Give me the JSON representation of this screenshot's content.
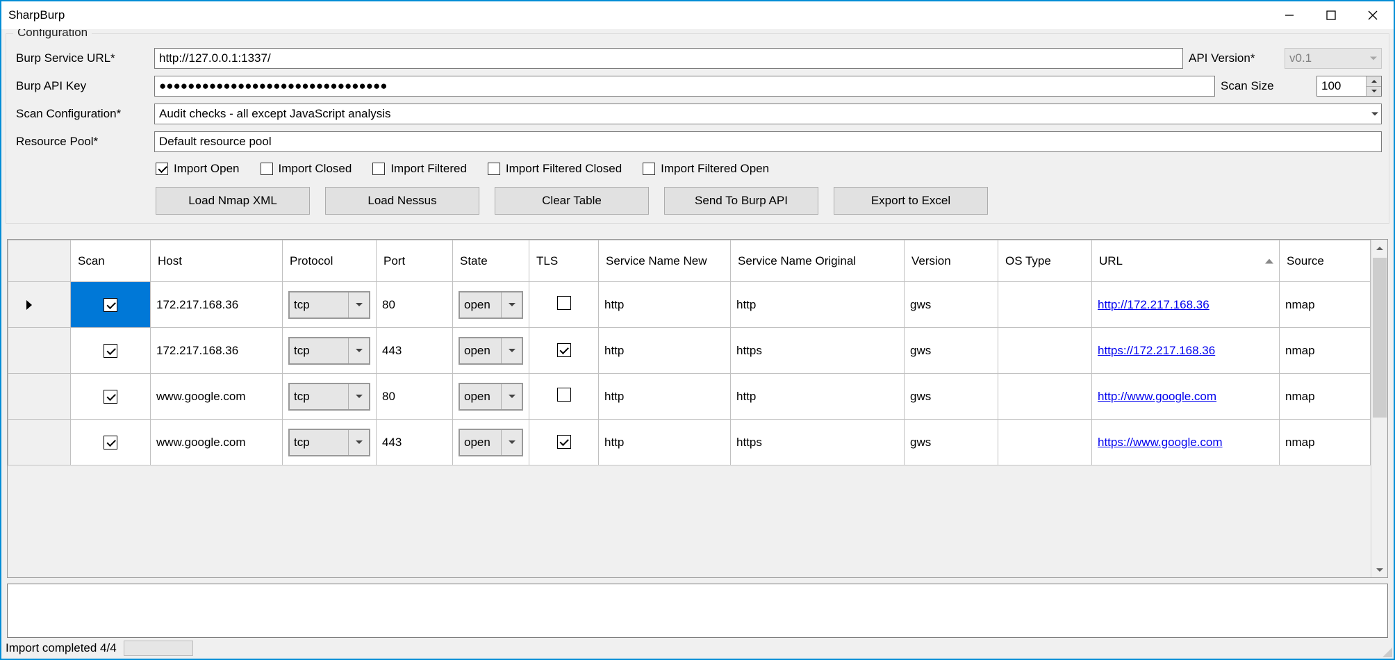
{
  "window": {
    "title": "SharpBurp"
  },
  "config": {
    "groupLabel": "Configuration",
    "labels": {
      "burpUrl": "Burp Service URL*",
      "apiKey": "Burp API Key",
      "scanConfig": "Scan Configuration*",
      "resourcePool": "Resource Pool*",
      "apiVersion": "API Version*",
      "scanSize": "Scan Size"
    },
    "values": {
      "burpUrl": "http://127.0.0.1:1337/",
      "apiKeyMasked": "●●●●●●●●●●●●●●●●●●●●●●●●●●●●●●●●",
      "scanConfig": "Audit checks - all except JavaScript analysis",
      "resourcePool": "Default resource pool",
      "apiVersion": "v0.1",
      "scanSize": "100"
    },
    "checkboxes": {
      "importOpen": {
        "label": "Import Open",
        "checked": true
      },
      "importClosed": {
        "label": "Import Closed",
        "checked": false
      },
      "importFiltered": {
        "label": "Import Filtered",
        "checked": false
      },
      "importFilteredClosed": {
        "label": "Import Filtered Closed",
        "checked": false
      },
      "importFilteredOpen": {
        "label": "Import Filtered Open",
        "checked": false
      }
    },
    "buttons": {
      "loadNmap": "Load Nmap XML",
      "loadNessus": "Load Nessus",
      "clearTable": "Clear Table",
      "sendBurp": "Send To Burp API",
      "exportExcel": "Export to Excel"
    }
  },
  "grid": {
    "columns": {
      "scan": "Scan",
      "host": "Host",
      "protocol": "Protocol",
      "port": "Port",
      "state": "State",
      "tls": "TLS",
      "serviceNameNew": "Service Name New",
      "serviceNameOriginal": "Service Name Original",
      "version": "Version",
      "osType": "OS Type",
      "url": "URL",
      "source": "Source"
    },
    "rows": [
      {
        "scan": true,
        "host": "172.217.168.36",
        "protocol": "tcp",
        "port": "80",
        "state": "open",
        "tls": false,
        "serviceNameNew": "http",
        "serviceNameOriginal": "http",
        "version": "gws",
        "osType": "",
        "url": "http://172.217.168.36",
        "source": "nmap"
      },
      {
        "scan": true,
        "host": "172.217.168.36",
        "protocol": "tcp",
        "port": "443",
        "state": "open",
        "tls": true,
        "serviceNameNew": "http",
        "serviceNameOriginal": "https",
        "version": "gws",
        "osType": "",
        "url": "https://172.217.168.36",
        "source": "nmap"
      },
      {
        "scan": true,
        "host": "www.google.com",
        "protocol": "tcp",
        "port": "80",
        "state": "open",
        "tls": false,
        "serviceNameNew": "http",
        "serviceNameOriginal": "http",
        "version": "gws",
        "osType": "",
        "url": "http://www.google.com",
        "source": "nmap"
      },
      {
        "scan": true,
        "host": "www.google.com",
        "protocol": "tcp",
        "port": "443",
        "state": "open",
        "tls": true,
        "serviceNameNew": "http",
        "serviceNameOriginal": "https",
        "version": "gws",
        "osType": "",
        "url": "https://www.google.com",
        "source": "nmap"
      }
    ]
  },
  "status": {
    "text": "Import completed  4/4"
  }
}
